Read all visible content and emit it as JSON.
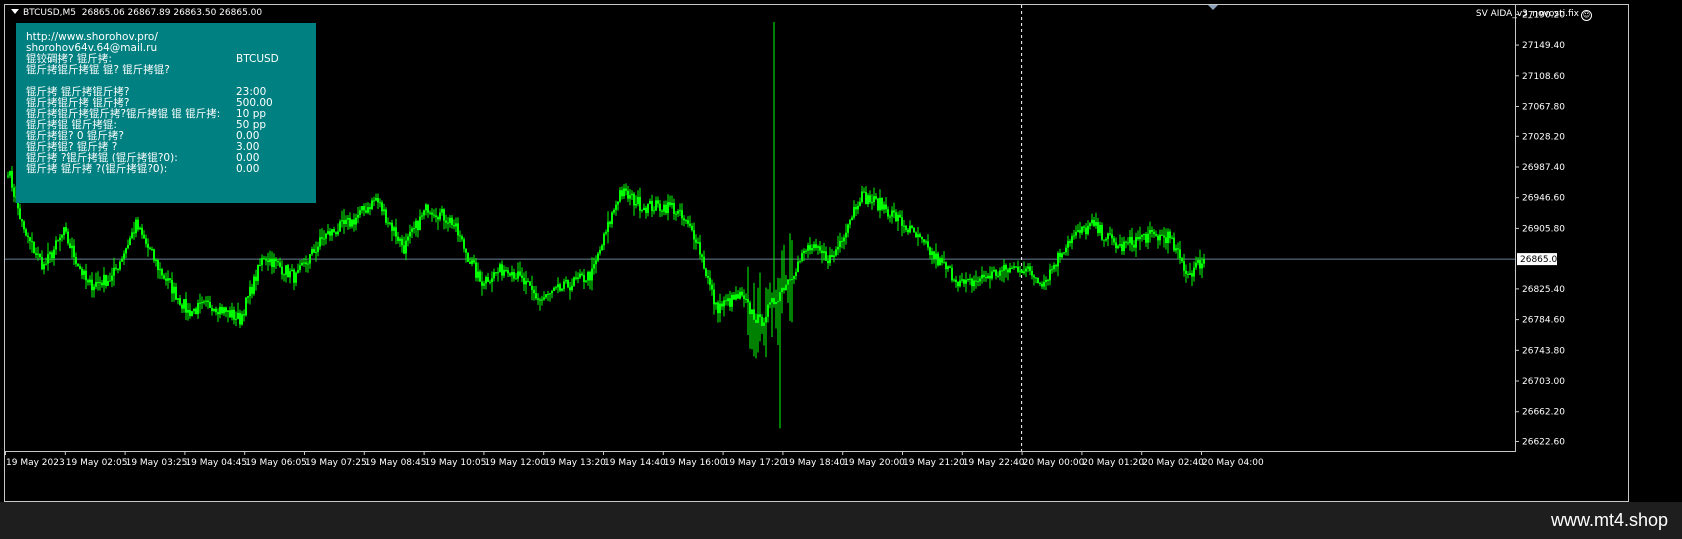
{
  "header": {
    "symbol": "BTCUSD,M5",
    "ohlc": "26865.06 26867.89 26863.50 26865.00"
  },
  "expert": {
    "name": "SV AIDA_v3_novosti.fix"
  },
  "info_panel": {
    "lines": [
      "http://www.shorohov.pro/",
      "shorohov64v.64@mail.ru",
      "锟铰碉拷? 锟斤拷:",
      "锟斤拷锟斤拷锟 锟? 锟斤拷锟?",
      "",
      "锟斤拷    锟斤拷锟斤拷?",
      "锟斤拷锟斤拷    锟斤拷?",
      "锟斤拷锟斤拷锟斤拷?锟斤拷锟 锟 锟斤拷:",
      "锟斤拷锟 锟斤拷锟:",
      "锟斤拷锟?          0        锟斤拷?",
      "锟斤拷锟? 锟斤拷    ?",
      "锟斤拷    ?锟斤拷锟     (锟斤拷锟?0):",
      "锟斤拷    锟斤拷    ?(锟斤拷锟?0):"
    ],
    "values": [
      "",
      "",
      "BTCUSD",
      "",
      "",
      "23:00",
      "500.00",
      "10 pp",
      "50 pp",
      "0.00",
      "3.00",
      "0.00",
      "0.00"
    ]
  },
  "price_axis": {
    "ticks": [
      "27190.20",
      "27149.40",
      "27108.60",
      "27067.80",
      "27028.20",
      "26987.40",
      "26946.60",
      "26905.80",
      "26825.40",
      "26784.60",
      "26743.80",
      "26703.00",
      "26662.20",
      "26622.60"
    ],
    "current_price": "26865.00"
  },
  "time_axis": {
    "ticks": [
      "19 May 2023",
      "19 May 02:05",
      "19 May 03:25",
      "19 May 04:45",
      "19 May 06:05",
      "19 May 07:25",
      "19 May 08:45",
      "19 May 10:05",
      "19 May 12:00",
      "19 May 13:20",
      "19 May 14:40",
      "19 May 16:00",
      "19 May 17:20",
      "19 May 18:40",
      "19 May 20:00",
      "19 May 21:20",
      "19 May 22:40",
      "20 May 00:00",
      "20 May 01:20",
      "20 May 02:40",
      "20 May 04:00"
    ]
  },
  "chart_data": {
    "type": "candlestick",
    "symbol": "BTCUSD",
    "timeframe": "M5",
    "current_price": 26865.0,
    "y_range": [
      26610,
      27200
    ],
    "bar_color": "#00ff00",
    "grid": false,
    "segments": [
      {
        "idx": 0,
        "price": 26985
      },
      {
        "idx": 8,
        "price": 26900
      },
      {
        "idx": 18,
        "price": 26855
      },
      {
        "idx": 28,
        "price": 26900
      },
      {
        "idx": 40,
        "price": 26830
      },
      {
        "idx": 52,
        "price": 26840
      },
      {
        "idx": 64,
        "price": 26910
      },
      {
        "idx": 76,
        "price": 26850
      },
      {
        "idx": 90,
        "price": 26795
      },
      {
        "idx": 102,
        "price": 26805
      },
      {
        "idx": 116,
        "price": 26785
      },
      {
        "idx": 128,
        "price": 26870
      },
      {
        "idx": 144,
        "price": 26840
      },
      {
        "idx": 158,
        "price": 26895
      },
      {
        "idx": 172,
        "price": 26915
      },
      {
        "idx": 184,
        "price": 26945
      },
      {
        "idx": 198,
        "price": 26880
      },
      {
        "idx": 210,
        "price": 26935
      },
      {
        "idx": 222,
        "price": 26915
      },
      {
        "idx": 236,
        "price": 26835
      },
      {
        "idx": 250,
        "price": 26855
      },
      {
        "idx": 266,
        "price": 26810
      },
      {
        "idx": 280,
        "price": 26830
      },
      {
        "idx": 292,
        "price": 26845
      },
      {
        "idx": 306,
        "price": 26955
      },
      {
        "idx": 318,
        "price": 26935
      },
      {
        "idx": 332,
        "price": 26935
      },
      {
        "idx": 344,
        "price": 26895
      },
      {
        "idx": 354,
        "price": 26800
      },
      {
        "idx": 366,
        "price": 26815
      },
      {
        "idx": 376,
        "price": 26780
      },
      {
        "idx": 388,
        "price": 26830
      },
      {
        "idx": 400,
        "price": 26880
      },
      {
        "idx": 412,
        "price": 26865
      },
      {
        "idx": 426,
        "price": 26950
      },
      {
        "idx": 438,
        "price": 26935
      },
      {
        "idx": 452,
        "price": 26900
      },
      {
        "idx": 466,
        "price": 26860
      },
      {
        "idx": 478,
        "price": 26830
      },
      {
        "idx": 492,
        "price": 26845
      },
      {
        "idx": 506,
        "price": 26855
      },
      {
        "idx": 518,
        "price": 26835
      },
      {
        "idx": 530,
        "price": 26890
      },
      {
        "idx": 542,
        "price": 26910
      },
      {
        "idx": 556,
        "price": 26880
      },
      {
        "idx": 568,
        "price": 26895
      },
      {
        "idx": 580,
        "price": 26895
      },
      {
        "idx": 590,
        "price": 26845
      },
      {
        "idx": 598,
        "price": 26865
      }
    ],
    "volatile_zone": [
      370,
      392
    ],
    "spike_high": 27180,
    "spike_low": 26640
  }
}
